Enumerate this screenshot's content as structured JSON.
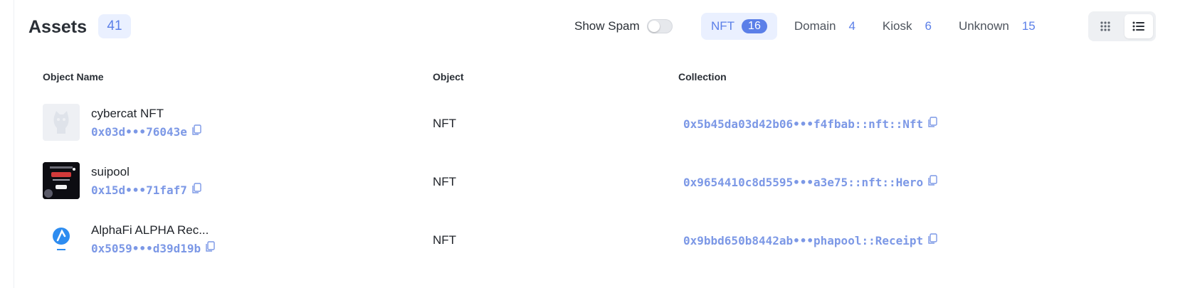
{
  "header": {
    "title": "Assets",
    "total_count": "41",
    "show_spam_label": "Show Spam",
    "show_spam_enabled": false
  },
  "tabs": [
    {
      "label": "NFT",
      "count": "16",
      "active": true
    },
    {
      "label": "Domain",
      "count": "4",
      "active": false
    },
    {
      "label": "Kiosk",
      "count": "6",
      "active": false
    },
    {
      "label": "Unknown",
      "count": "15",
      "active": false
    }
  ],
  "view_toggle": {
    "grid_icon": "grid-icon",
    "list_icon": "list-icon",
    "active": "list"
  },
  "table": {
    "columns": [
      "Object Name",
      "Object",
      "Collection"
    ],
    "rows": [
      {
        "name": "cybercat NFT",
        "address": "0x03d•••76043e",
        "object": "NFT",
        "collection": "0x5b45da03d42b06•••f4fbab::nft::Nft",
        "thumb": "placeholder-icon"
      },
      {
        "name": "suipool",
        "address": "0x15d•••71faf7",
        "object": "NFT",
        "collection": "0x9654410c8d5595•••a3e75::nft::Hero",
        "thumb": "nft-image"
      },
      {
        "name": "AlphaFi ALPHA Rec...",
        "address": "0x5059•••d39d19b",
        "object": "NFT",
        "collection": "0x9bbd650b8442ab•••phapool::Receipt",
        "thumb": "alphafi-logo"
      }
    ]
  },
  "colors": {
    "accent": "#5b7fe8",
    "accent_bg": "#eaf0ff",
    "link": "#7c98e6"
  }
}
